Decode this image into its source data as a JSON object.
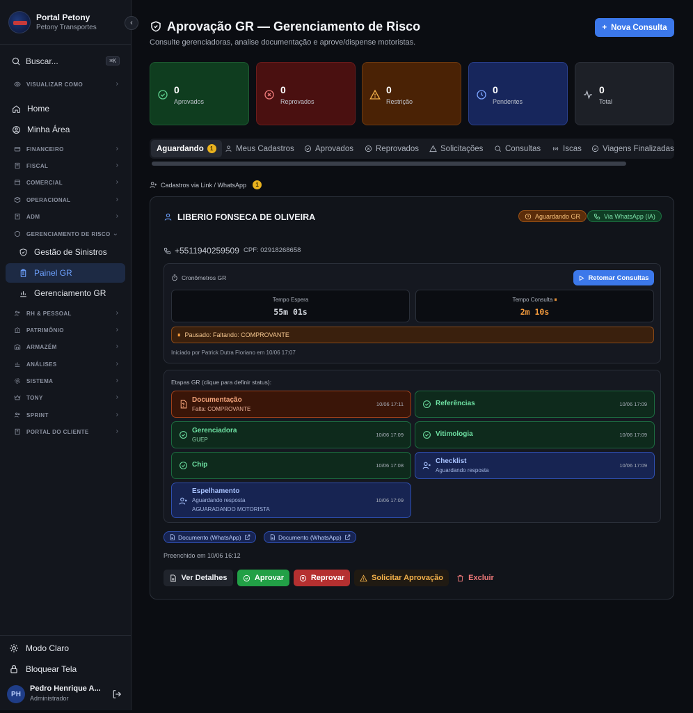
{
  "sidebar": {
    "brand_title": "Portal Petony",
    "brand_subtitle": "Petony Transportes",
    "search_label": "Buscar...",
    "search_shortcut": "⌘K",
    "items": [
      {
        "label": "VISUALIZAR COMO"
      },
      {
        "label": "Home"
      },
      {
        "label": "Minha Área"
      },
      {
        "label": "FINANCEIRO"
      },
      {
        "label": "FISCAL"
      },
      {
        "label": "COMERCIAL"
      },
      {
        "label": "OPERACIONAL"
      },
      {
        "label": "ADM"
      },
      {
        "label": "GERENCIAMENTO DE RISCO"
      },
      {
        "label": "Gestão de Sinistros"
      },
      {
        "label": "Painel GR"
      },
      {
        "label": "Gerenciamento GR"
      },
      {
        "label": "RH & PESSOAL"
      },
      {
        "label": "PATRIMÔNIO"
      },
      {
        "label": "ARMAZÉM"
      },
      {
        "label": "ANÁLISES"
      },
      {
        "label": "SISTEMA"
      },
      {
        "label": "TONY"
      },
      {
        "label": "SPRINT"
      },
      {
        "label": "PORTAL DO CLIENTE"
      }
    ],
    "theme_label": "Modo Claro",
    "lock_label": "Bloquear Tela",
    "user": {
      "initials": "PH",
      "name": "Pedro Henrique A...",
      "role": "Administrador"
    }
  },
  "header": {
    "title": "Aprovação GR — Gerenciamento de Risco",
    "subtitle": "Consulte gerenciadoras, analise documentação e aprove/dispense motoristas.",
    "new_button": "Nova Consulta"
  },
  "stats": [
    {
      "value": "0",
      "label": "Aprovados",
      "color": "#0f3d1f"
    },
    {
      "value": "0",
      "label": "Reprovados",
      "color": "#4a1010"
    },
    {
      "value": "0",
      "label": "Restrição",
      "color": "#4a2205"
    },
    {
      "value": "0",
      "label": "Pendentes",
      "color": "#17265c"
    },
    {
      "value": "0",
      "label": "Total",
      "color": "#1d2027"
    }
  ],
  "tabs": [
    {
      "label": "Aguardando",
      "count": "1"
    },
    {
      "label": "Meus Cadastros"
    },
    {
      "label": "Aprovados"
    },
    {
      "label": "Reprovados"
    },
    {
      "label": "Solicitações"
    },
    {
      "label": "Consultas"
    },
    {
      "label": "Iscas"
    },
    {
      "label": "Viagens Finalizadas"
    }
  ],
  "section": {
    "label": "Cadastros via Link / WhatsApp",
    "count": "1"
  },
  "card": {
    "name": "LIBERIO FONSECA DE OLIVEIRA",
    "badge_status": "Aguardando GR",
    "badge_source": "Via WhatsApp (IA)",
    "phone": "+5511940259509",
    "cpf": "CPF: 02918268658",
    "cronometros": {
      "title": "Cronômetros GR",
      "retomar_button": "Retomar Consultas",
      "espera_label": "Tempo Espera",
      "espera_value": "55m 01s",
      "consulta_label": "Tempo Consulta",
      "consulta_value": "2m 10s",
      "paused_text": "Pausado: Faltando: COMPROVANTE",
      "started_text": "Iniciado por Patrick Dutra Floriano em 10/06 17:07"
    },
    "etapas": {
      "title": "Etapas GR (clique para definir status):",
      "steps": [
        {
          "title": "Documentação",
          "detail": "Falta: COMPROVANTE",
          "detail2": "",
          "time": "10/06 17:11",
          "state": "red"
        },
        {
          "title": "Referências",
          "detail": "",
          "detail2": "",
          "time": "10/06 17:09",
          "state": "green"
        },
        {
          "title": "Gerenciadora",
          "detail": "GUEP",
          "detail2": "",
          "time": "10/06 17:09",
          "state": "green"
        },
        {
          "title": "Vitimologia",
          "detail": "",
          "detail2": "",
          "time": "10/06 17:09",
          "state": "green"
        },
        {
          "title": "Chip",
          "detail": "",
          "detail2": "",
          "time": "10/06 17:08",
          "state": "green"
        },
        {
          "title": "Checklist",
          "detail": "Aguardando resposta",
          "detail2": "",
          "time": "10/06 17:09",
          "state": "blue"
        },
        {
          "title": "Espelhamento",
          "detail": "Aguardando resposta",
          "detail2": "AGUARADANDO MOTORISTA",
          "time": "10/06 17:09",
          "state": "blue"
        }
      ]
    },
    "docs": [
      "Documento (WhatsApp)",
      "Documento (WhatsApp)"
    ],
    "filled": "Preenchido em 10/06 16:12",
    "actions": {
      "details": "Ver Detalhes",
      "approve": "Aprovar",
      "reject": "Reprovar",
      "request": "Solicitar Aprovação",
      "delete": "Excluir"
    }
  }
}
